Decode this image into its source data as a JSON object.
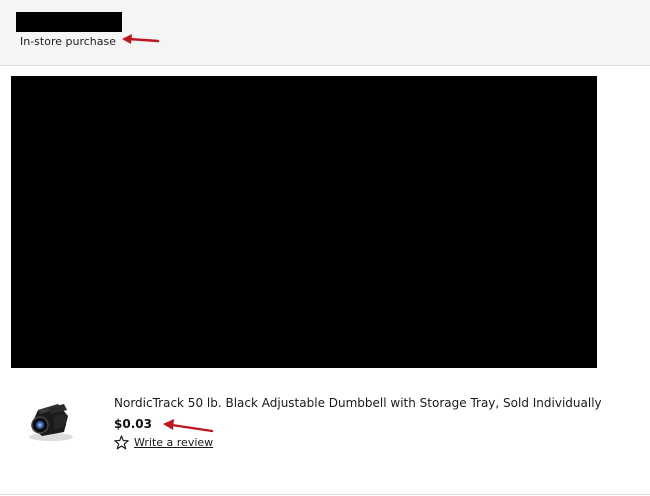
{
  "header": {
    "purchase_type": "In-store purchase"
  },
  "product": {
    "title": "NordicTrack 50 lb. Black Adjustable Dumbbell with Storage Tray, Sold Individually",
    "price": "$0.03",
    "review_link": "Write a review",
    "thumbnail_icon": "dumbbell-image",
    "star_icon": "star-outline-icon"
  },
  "annotations": {
    "arrow_color": "#c0161d"
  }
}
